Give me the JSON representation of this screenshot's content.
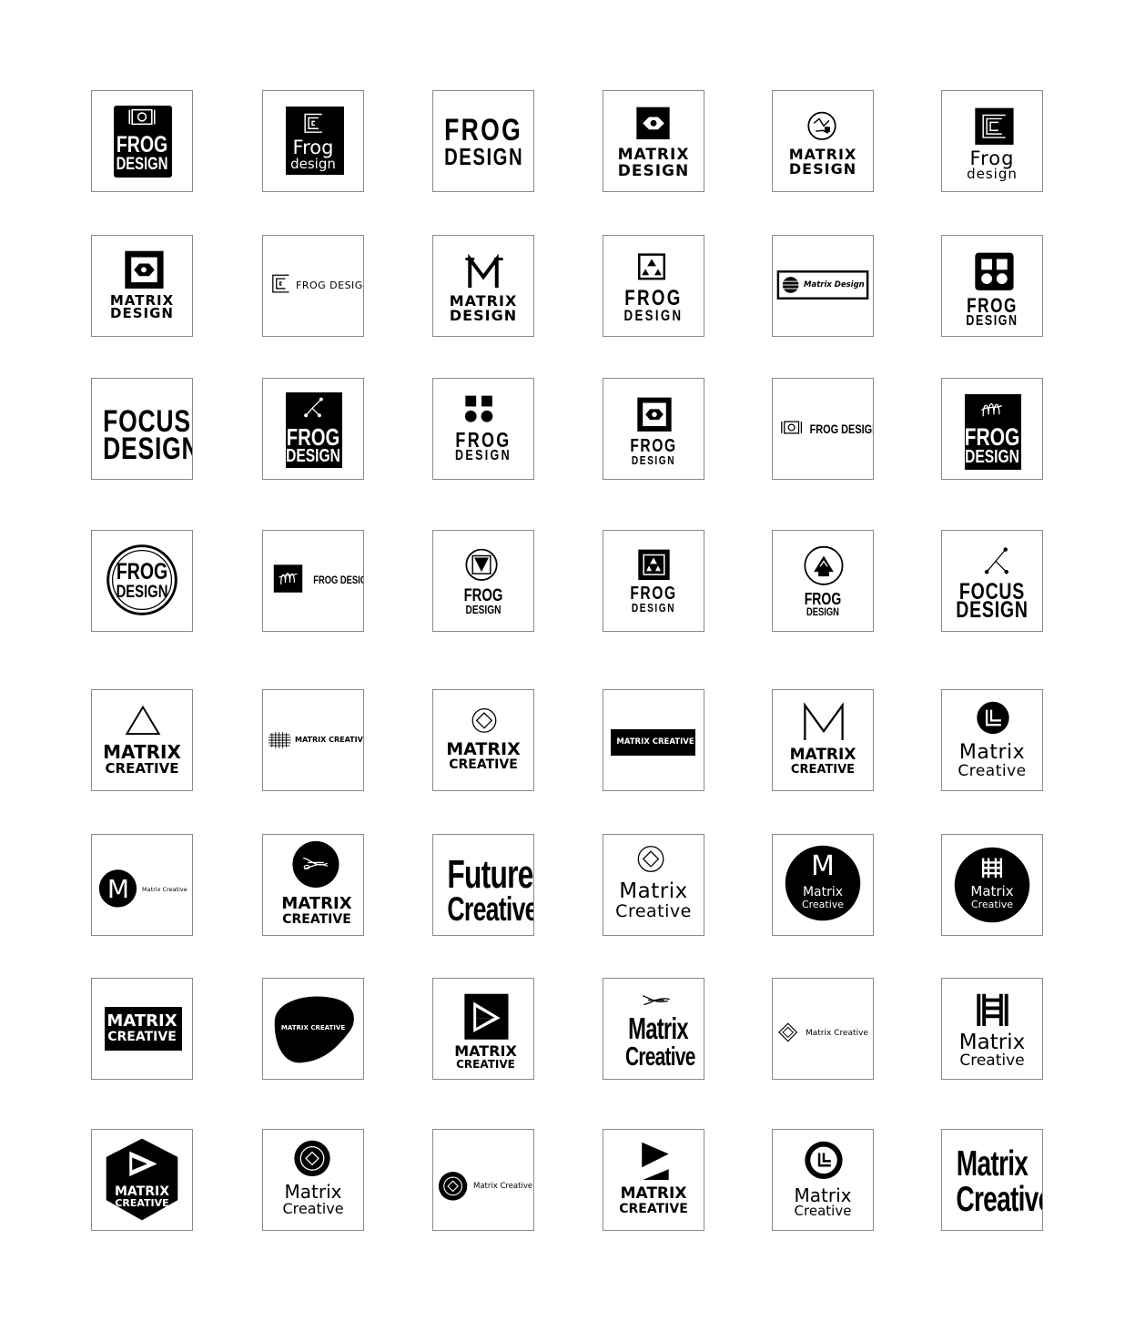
{
  "palette": {
    "ink": "#000000",
    "paper": "#ffffff",
    "frame": "#8a8a8a"
  },
  "rows": [
    [
      {
        "line1": "FROG",
        "line2": "DESIGN",
        "icon": "fork-plate-icon"
      },
      {
        "line1": "Frog",
        "line2": "design",
        "icon": "square-spiral-icon"
      },
      {
        "line1": "FROG",
        "line2": "DESIGN"
      },
      {
        "line1": "MATRIX",
        "line2": "DESIGN",
        "icon": "hexagon-eye-icon"
      },
      {
        "line1": "MATRIX",
        "line2": "DESIGN",
        "icon": "circle-sketch-icon"
      },
      {
        "line1": "Frog",
        "line2": "design",
        "icon": "square-spiral-icon"
      }
    ],
    [
      {
        "line1": "MATRIX",
        "line2": "DESIGN",
        "icon": "framed-hexagon-icon"
      },
      {
        "line1": "FROG DESIGN",
        "icon": "square-spiral-icon"
      },
      {
        "line1": "MATRIX",
        "line2": "DESIGN",
        "icon": "letter-m-icon"
      },
      {
        "line1": "FROG",
        "line2": "DESIGN",
        "icon": "triangles-square-icon"
      },
      {
        "line1": "Matrix Design",
        "icon": "striped-globe-icon"
      },
      {
        "line1": "FROG",
        "line2": "DESIGN",
        "icon": "four-squares-icon"
      }
    ],
    [
      {
        "line1": "FOCUS",
        "line2": "DESIGN"
      },
      {
        "line1": "FROG",
        "line2": "DESIGN",
        "icon": "node-graph-icon"
      },
      {
        "line1": "FROG",
        "line2": "DESIGN",
        "icon": "squares-circles-icon"
      },
      {
        "line1": "FROG",
        "line2": "DESIGN",
        "icon": "framed-hexagon-icon"
      },
      {
        "line1": "FROG DESIGN",
        "icon": "fork-plate-icon"
      },
      {
        "line1": "FROG",
        "line2": "DESIGN",
        "icon": "scribble-icon"
      }
    ],
    [
      {
        "line1": "FROG",
        "line2": "DESIGN",
        "icon": "double-ring-icon"
      },
      {
        "line1": "FROG DESIGN",
        "icon": "scribble-icon"
      },
      {
        "line1": "FROG",
        "line2": "DESIGN",
        "icon": "circle-triangle-icon"
      },
      {
        "line1": "FROG",
        "line2": "DESIGN",
        "icon": "triangles-square-icon"
      },
      {
        "line1": "FROG",
        "line2": "DESIGN",
        "icon": "circle-house-icon"
      },
      {
        "line1": "FOCUS",
        "line2": "DESIGN",
        "icon": "node-graph-icon"
      }
    ],
    [
      {
        "line1": "MATRIX",
        "line2": "CREATIVE",
        "icon": "triangle-icon"
      },
      {
        "line1": "MATRIX CREATIVE",
        "icon": "mesh-icon"
      },
      {
        "line1": "MATRIX",
        "line2": "CREATIVE",
        "icon": "circle-diamond-icon"
      },
      {
        "line1": "MATRIX CREATIVE"
      },
      {
        "line1": "MATRIX",
        "line2": "CREATIVE",
        "icon": "letter-m-icon"
      },
      {
        "line1": "Matrix",
        "line2": "Creative",
        "icon": "circle-corner-icon"
      }
    ],
    [
      {
        "line1": "M",
        "line2": "Matrix Creative",
        "icon": "circle-m-icon"
      },
      {
        "line1": "MATRIX",
        "line2": "CREATIVE",
        "icon": "circle-knot-icon"
      },
      {
        "line1": "Future",
        "line2": "Creative"
      },
      {
        "line1": "Matrix",
        "line2": "Creative",
        "icon": "circle-diamond-icon"
      },
      {
        "line1": "M",
        "line2": "Matrix",
        "line3": "Creative",
        "icon": "circle-m-icon"
      },
      {
        "line1": "Matrix",
        "line2": "Creative",
        "icon": "ladder-icon"
      }
    ],
    [
      {
        "line1": "MATRIX",
        "line2": "CREATIVE"
      },
      {
        "line1": "MATRIX CREATIVE",
        "icon": "blob-icon"
      },
      {
        "line1": "MATRIX",
        "line2": "CREATIVE",
        "icon": "arrow-square-icon"
      },
      {
        "line1": "Matrix",
        "line2": "Creative",
        "icon": "knot-icon"
      },
      {
        "line1": "Matrix Creative",
        "icon": "diamond-icon"
      },
      {
        "line1": "Matrix",
        "line2": "Creative",
        "icon": "ladder-icon"
      }
    ],
    [
      {
        "line1": "MATRIX",
        "line2": "CREATIVE",
        "icon": "hexagon-arrow-icon"
      },
      {
        "line1": "Matrix",
        "line2": "Creative",
        "icon": "circle-diamond-icon"
      },
      {
        "line1": "Matrix Creative",
        "icon": "circle-diamond-icon"
      },
      {
        "line1": "MATRIX",
        "line2": "CREATIVE",
        "icon": "bowtie-icon"
      },
      {
        "line1": "Matrix",
        "line2": "Creative",
        "icon": "circle-corner-icon"
      },
      {
        "line1": "Matrix",
        "line2": "Creative"
      }
    ]
  ]
}
